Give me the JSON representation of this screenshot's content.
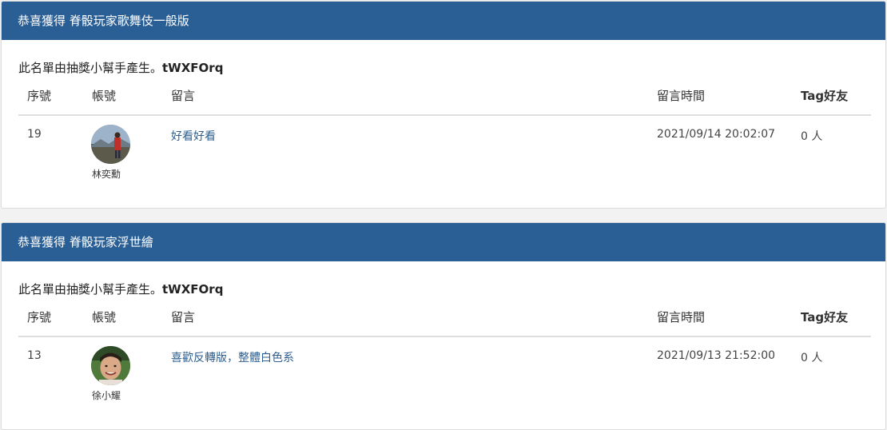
{
  "cards": [
    {
      "title": "恭喜獲得 脊骰玩家歌舞伎一般版",
      "generator_prefix": "此名單由抽獎小幫手產生。",
      "generator_code": "tWXFOrq",
      "columns": [
        "序號",
        "帳號",
        "留言",
        "留言時間",
        "Tag好友"
      ],
      "row": {
        "number": "19",
        "account_name": "林奕勳",
        "message": "好看好看",
        "time": "2021/09/14 20:02:07",
        "tags": "0 人"
      }
    },
    {
      "title": "恭喜獲得 脊骰玩家浮世繪",
      "generator_prefix": "此名單由抽獎小幫手產生。",
      "generator_code": "tWXFOrq",
      "columns": [
        "序號",
        "帳號",
        "留言",
        "留言時間",
        "Tag好友"
      ],
      "row": {
        "number": "13",
        "account_name": "徐小耀",
        "message": "喜歡反轉版，整體白色系",
        "time": "2021/09/13 21:52:00",
        "tags": "0 人"
      }
    }
  ],
  "colors": {
    "header_bg": "#2a5f96",
    "link": "#2e5f8f"
  }
}
